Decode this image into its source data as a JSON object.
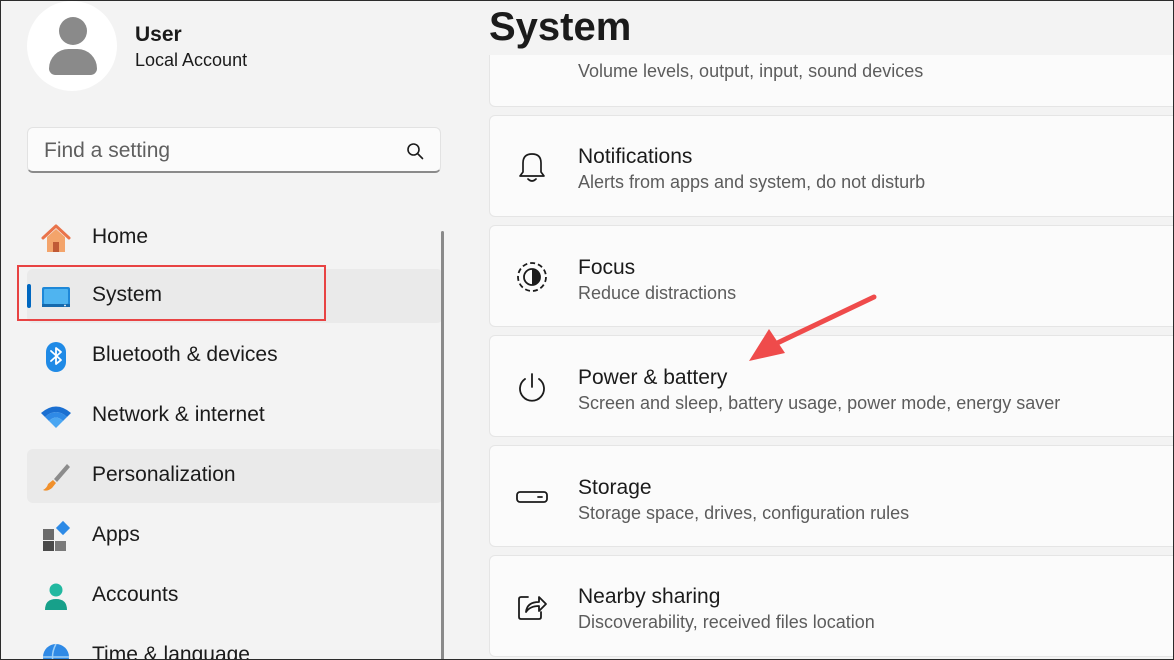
{
  "user": {
    "name": "User",
    "account_type": "Local Account"
  },
  "search": {
    "placeholder": "Find a setting",
    "icon": "search-icon"
  },
  "sidebar": {
    "items": [
      {
        "label": "Home",
        "icon": "home-icon"
      },
      {
        "label": "System",
        "icon": "system-icon",
        "active": true
      },
      {
        "label": "Bluetooth & devices",
        "icon": "bluetooth-icon"
      },
      {
        "label": "Network & internet",
        "icon": "wifi-icon"
      },
      {
        "label": "Personalization",
        "icon": "brush-icon"
      },
      {
        "label": "Apps",
        "icon": "apps-icon"
      },
      {
        "label": "Accounts",
        "icon": "account-icon"
      },
      {
        "label": "Time & language",
        "icon": "globe-icon"
      }
    ]
  },
  "main": {
    "title": "System",
    "partial_card_subtitle": "Volume levels, output, input, sound devices",
    "cards": [
      {
        "title": "Notifications",
        "subtitle": "Alerts from apps and system, do not disturb",
        "icon": "bell-icon"
      },
      {
        "title": "Focus",
        "subtitle": "Reduce distractions",
        "icon": "focus-icon"
      },
      {
        "title": "Power & battery",
        "subtitle": "Screen and sleep, battery usage, power mode, energy saver",
        "icon": "power-icon"
      },
      {
        "title": "Storage",
        "subtitle": "Storage space, drives, configuration rules",
        "icon": "storage-icon"
      },
      {
        "title": "Nearby sharing",
        "subtitle": "Discoverability, received files location",
        "icon": "share-icon"
      }
    ]
  },
  "colors": {
    "accent": "#0067c0",
    "highlight": "#e84343",
    "annotation_arrow": "#ef4b4b"
  }
}
